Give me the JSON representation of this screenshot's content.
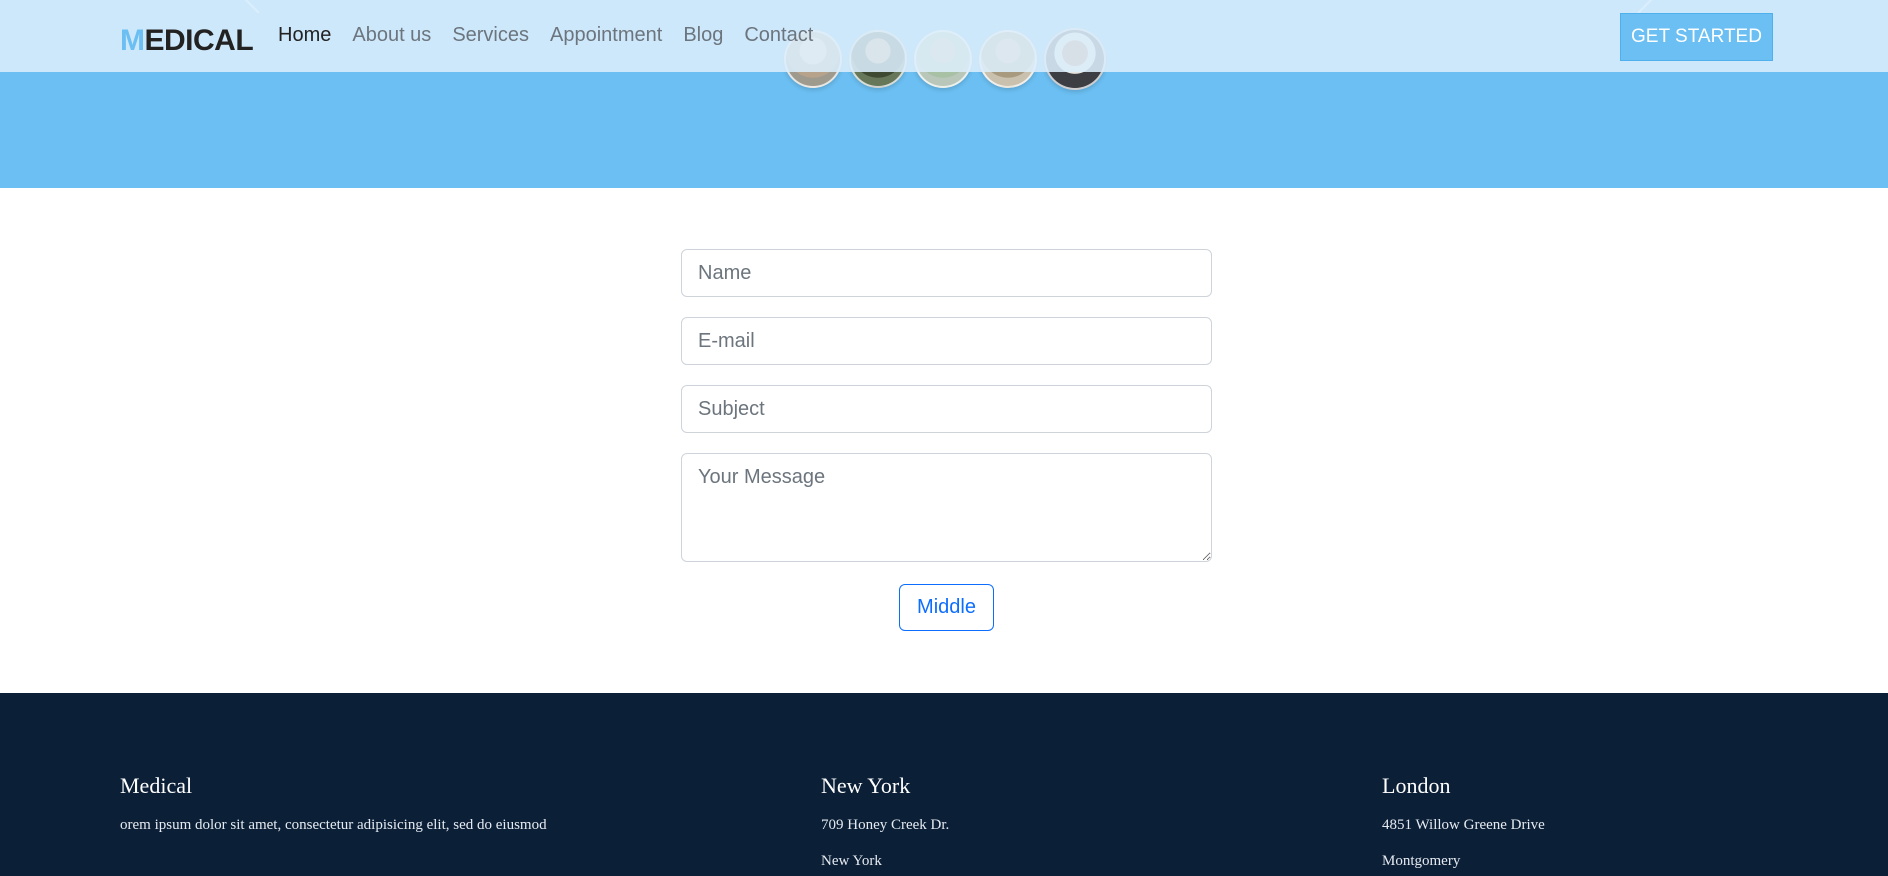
{
  "brand": {
    "logo_first": "M",
    "logo_rest": "EDICAL"
  },
  "nav": {
    "items": [
      {
        "label": "Home",
        "active": true
      },
      {
        "label": "About us"
      },
      {
        "label": "Services"
      },
      {
        "label": "Appointment"
      },
      {
        "label": "Blog"
      },
      {
        "label": "Contact"
      }
    ],
    "cta_label": "GET STARTED"
  },
  "hero": {
    "avatar_count": 5,
    "accent_color": "#6bbff2"
  },
  "form": {
    "name_placeholder": "Name",
    "email_placeholder": "E-mail",
    "subject_placeholder": "Subject",
    "message_placeholder": "Your Message",
    "submit_label": "Middle"
  },
  "footer": {
    "columns": [
      {
        "heading": "Medical",
        "lines": [
          "orem ipsum dolor sit amet, consectetur adipisicing elit, sed do eiusmod"
        ]
      },
      {
        "heading": "New York",
        "lines": [
          "709 Honey Creek Dr.",
          "New York"
        ]
      },
      {
        "heading": "London",
        "lines": [
          "4851 Willow Greene Drive",
          "Montgomery"
        ]
      }
    ],
    "background_color": "#0b1f37"
  }
}
